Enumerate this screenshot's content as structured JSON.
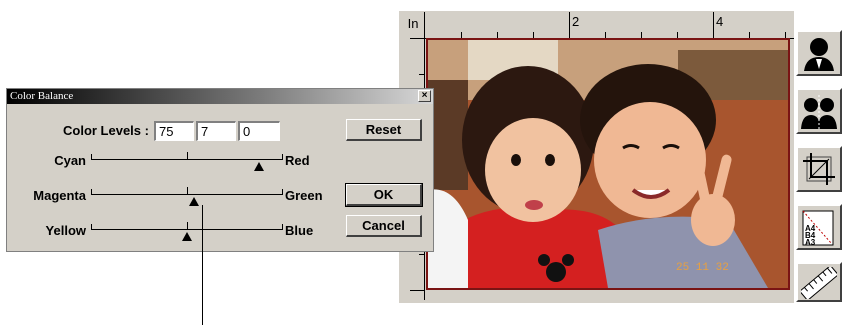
{
  "preview": {
    "unit": "In",
    "ruler_numbers": [
      "2",
      "4"
    ],
    "date_stamp": "25 11 32"
  },
  "tools": [
    "single-portrait-icon",
    "dual-portrait-icon",
    "crop-icon",
    "paper-size-icon",
    "ruler-icon"
  ],
  "paper_sizes": [
    "A4",
    "B4",
    "A3"
  ],
  "dialog": {
    "title": "Color Balance",
    "close_glyph": "×",
    "color_levels_label": "Color Levels :",
    "levels": [
      "75",
      "7",
      "0"
    ],
    "sliders": [
      {
        "left": "Cyan",
        "right": "Red",
        "value": 75
      },
      {
        "left": "Magenta",
        "right": "Green",
        "value": 7
      },
      {
        "left": "Yellow",
        "right": "Blue",
        "value": 0
      }
    ],
    "buttons": {
      "reset": "Reset",
      "ok": "OK",
      "cancel": "Cancel"
    }
  }
}
